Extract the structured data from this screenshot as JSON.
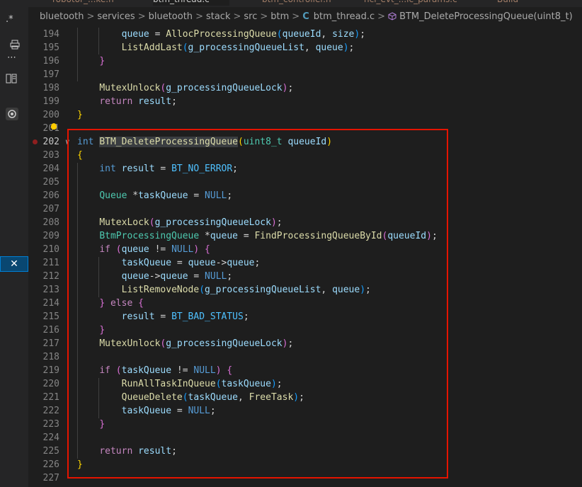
{
  "tabs": [
    {
      "label": "robotor_...ke.h",
      "active": false
    },
    {
      "label": "btm_thread.c",
      "active": true
    },
    {
      "label": "btm_controller.h",
      "active": false
    },
    {
      "label": "hci_evt_...ic_params.c",
      "active": false
    },
    {
      "label": "Build",
      "active": false
    }
  ],
  "left_strip": {
    "item1": ".*",
    "item2": "⋯",
    "close": "✕"
  },
  "breadcrumb": [
    "bluetooth",
    "services",
    "bluetooth",
    "stack",
    "src",
    "btm",
    "btm_thread.c",
    "BTM_DeleteProcessingQueue(uint8_t)"
  ],
  "breadcrumb_sep": ">",
  "file_icon_letter": "C",
  "line_numbers": [
    "194",
    "195",
    "196",
    "197",
    "198",
    "199",
    "200",
    "201",
    "202",
    "203",
    "204",
    "205",
    "206",
    "207",
    "208",
    "209",
    "210",
    "211",
    "212",
    "213",
    "214",
    "215",
    "216",
    "217",
    "218",
    "219",
    "220",
    "221",
    "222",
    "223",
    "224",
    "225",
    "226",
    "227"
  ],
  "code": {
    "l194": [
      [
        "",
        "        "
      ],
      [
        "var",
        "queue"
      ],
      [
        "",
        " = "
      ],
      [
        "fn",
        "AllocProcessingQueue"
      ],
      [
        "b3",
        "("
      ],
      [
        "var",
        "queueId"
      ],
      [
        "",
        ", "
      ],
      [
        "var",
        "size"
      ],
      [
        "b3",
        ")"
      ],
      [
        "",
        ";"
      ]
    ],
    "l195": [
      [
        "",
        "        "
      ],
      [
        "fn",
        "ListAddLast"
      ],
      [
        "b3",
        "("
      ],
      [
        "var",
        "g_processingQueueList"
      ],
      [
        "",
        ", "
      ],
      [
        "var",
        "queue"
      ],
      [
        "b3",
        ")"
      ],
      [
        "",
        ";"
      ]
    ],
    "l196": [
      [
        "",
        "    "
      ],
      [
        "b2",
        "}"
      ]
    ],
    "l197": [],
    "l198": [
      [
        "",
        "    "
      ],
      [
        "fn",
        "MutexUnlock"
      ],
      [
        "b2",
        "("
      ],
      [
        "var",
        "g_processingQueueLock"
      ],
      [
        "b2",
        ")"
      ],
      [
        "",
        ";"
      ]
    ],
    "l199": [
      [
        "",
        "    "
      ],
      [
        "ctl",
        "return"
      ],
      [
        "",
        " "
      ],
      [
        "var",
        "result"
      ],
      [
        "",
        ";"
      ]
    ],
    "l200": [
      [
        "b1",
        "}"
      ]
    ],
    "l201": [],
    "l202": [
      [
        "kw",
        "int"
      ],
      [
        "",
        " "
      ],
      [
        "fn hl",
        "BTM_DeleteProcessingQueue"
      ],
      [
        "b1",
        "("
      ],
      [
        "ty",
        "uint8_t"
      ],
      [
        "",
        " "
      ],
      [
        "var",
        "queueId"
      ],
      [
        "b1",
        ")"
      ]
    ],
    "l203": [
      [
        "b1",
        "{"
      ]
    ],
    "l204": [
      [
        "",
        "    "
      ],
      [
        "kw",
        "int"
      ],
      [
        "",
        " "
      ],
      [
        "var",
        "result"
      ],
      [
        "",
        " = "
      ],
      [
        "con",
        "BT_NO_ERROR"
      ],
      [
        "",
        ";"
      ]
    ],
    "l205": [],
    "l206": [
      [
        "",
        "    "
      ],
      [
        "ty",
        "Queue"
      ],
      [
        "",
        " *"
      ],
      [
        "var",
        "taskQueue"
      ],
      [
        "",
        " = "
      ],
      [
        "kw",
        "NULL"
      ],
      [
        "",
        ";"
      ]
    ],
    "l207": [],
    "l208": [
      [
        "",
        "    "
      ],
      [
        "fn",
        "MutexLock"
      ],
      [
        "b2",
        "("
      ],
      [
        "var",
        "g_processingQueueLock"
      ],
      [
        "b2",
        ")"
      ],
      [
        "",
        ";"
      ]
    ],
    "l209": [
      [
        "",
        "    "
      ],
      [
        "ty",
        "BtmProcessingQueue"
      ],
      [
        "",
        " *"
      ],
      [
        "var",
        "queue"
      ],
      [
        "",
        " = "
      ],
      [
        "fn",
        "FindProcessingQueueById"
      ],
      [
        "b2",
        "("
      ],
      [
        "var",
        "queueId"
      ],
      [
        "b2",
        ")"
      ],
      [
        "",
        ";"
      ]
    ],
    "l210": [
      [
        "",
        "    "
      ],
      [
        "ctl",
        "if"
      ],
      [
        "",
        " "
      ],
      [
        "b2",
        "("
      ],
      [
        "var",
        "queue"
      ],
      [
        "",
        " != "
      ],
      [
        "kw",
        "NULL"
      ],
      [
        "b2",
        ")"
      ],
      [
        "",
        " "
      ],
      [
        "b2",
        "{"
      ]
    ],
    "l211": [
      [
        "",
        "        "
      ],
      [
        "var",
        "taskQueue"
      ],
      [
        "",
        " = "
      ],
      [
        "var",
        "queue"
      ],
      [
        "",
        "->"
      ],
      [
        "var",
        "queue"
      ],
      [
        "",
        ";"
      ]
    ],
    "l212": [
      [
        "",
        "        "
      ],
      [
        "var",
        "queue"
      ],
      [
        "",
        "->"
      ],
      [
        "var",
        "queue"
      ],
      [
        "",
        " = "
      ],
      [
        "kw",
        "NULL"
      ],
      [
        "",
        ";"
      ]
    ],
    "l213": [
      [
        "",
        "        "
      ],
      [
        "fn",
        "ListRemoveNode"
      ],
      [
        "b3",
        "("
      ],
      [
        "var",
        "g_processingQueueList"
      ],
      [
        "",
        ", "
      ],
      [
        "var",
        "queue"
      ],
      [
        "b3",
        ")"
      ],
      [
        "",
        ";"
      ]
    ],
    "l214": [
      [
        "",
        "    "
      ],
      [
        "b2",
        "}"
      ],
      [
        "",
        " "
      ],
      [
        "ctl",
        "else"
      ],
      [
        "",
        " "
      ],
      [
        "b2",
        "{"
      ]
    ],
    "l215": [
      [
        "",
        "        "
      ],
      [
        "var",
        "result"
      ],
      [
        "",
        " = "
      ],
      [
        "con",
        "BT_BAD_STATUS"
      ],
      [
        "",
        ";"
      ]
    ],
    "l216": [
      [
        "",
        "    "
      ],
      [
        "b2",
        "}"
      ]
    ],
    "l217": [
      [
        "",
        "    "
      ],
      [
        "fn",
        "MutexUnlock"
      ],
      [
        "b2",
        "("
      ],
      [
        "var",
        "g_processingQueueLock"
      ],
      [
        "b2",
        ")"
      ],
      [
        "",
        ";"
      ]
    ],
    "l218": [],
    "l219": [
      [
        "",
        "    "
      ],
      [
        "ctl",
        "if"
      ],
      [
        "",
        " "
      ],
      [
        "b2",
        "("
      ],
      [
        "var",
        "taskQueue"
      ],
      [
        "",
        " != "
      ],
      [
        "kw",
        "NULL"
      ],
      [
        "b2",
        ")"
      ],
      [
        "",
        " "
      ],
      [
        "b2",
        "{"
      ]
    ],
    "l220": [
      [
        "",
        "        "
      ],
      [
        "fn",
        "RunAllTaskInQueue"
      ],
      [
        "b3",
        "("
      ],
      [
        "var",
        "taskQueue"
      ],
      [
        "b3",
        ")"
      ],
      [
        "",
        ";"
      ]
    ],
    "l221": [
      [
        "",
        "        "
      ],
      [
        "fn",
        "QueueDelete"
      ],
      [
        "b3",
        "("
      ],
      [
        "var",
        "taskQueue"
      ],
      [
        "",
        ", "
      ],
      [
        "fn",
        "FreeTask"
      ],
      [
        "b3",
        ")"
      ],
      [
        "",
        ";"
      ]
    ],
    "l222": [
      [
        "",
        "        "
      ],
      [
        "var",
        "taskQueue"
      ],
      [
        "",
        " = "
      ],
      [
        "kw",
        "NULL"
      ],
      [
        "",
        ";"
      ]
    ],
    "l223": [
      [
        "",
        "    "
      ],
      [
        "b2",
        "}"
      ]
    ],
    "l224": [],
    "l225": [
      [
        "",
        "    "
      ],
      [
        "ctl",
        "return"
      ],
      [
        "",
        " "
      ],
      [
        "var",
        "result"
      ],
      [
        "",
        ";"
      ]
    ],
    "l226": [
      [
        "b1",
        "}"
      ]
    ],
    "l227": []
  },
  "current_line": "202",
  "breakpoint_line": "202",
  "colors": {
    "highlight_box": "#e51400",
    "breakpoint": "#8f1f1f",
    "lightbulb": "#ffcc00"
  }
}
